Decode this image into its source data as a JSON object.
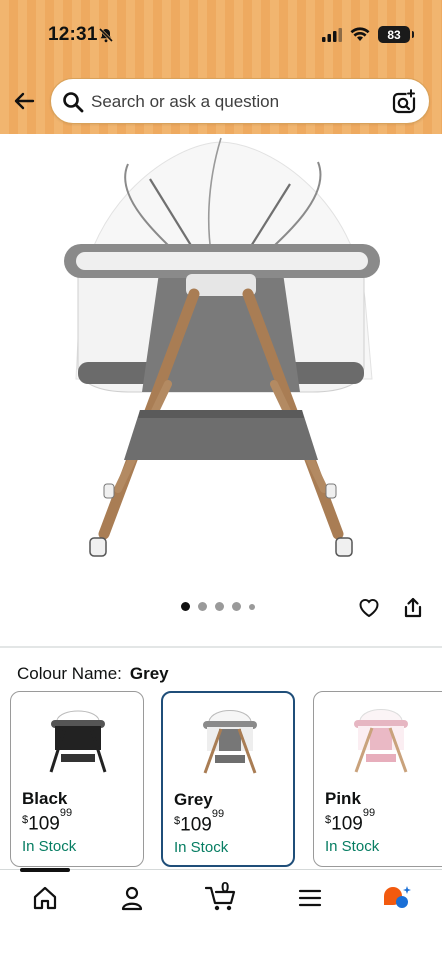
{
  "status_bar": {
    "time": "12:31",
    "battery": "83"
  },
  "search": {
    "placeholder": "Search or ask a question"
  },
  "gallery": {
    "dot_count": 5,
    "active_index": 0
  },
  "colour": {
    "label": "Colour Name:",
    "selected": "Grey"
  },
  "swatches": [
    {
      "name": "Black",
      "currency": "$",
      "price_whole": "109",
      "price_fraction": "99",
      "stock": "In Stock",
      "selected": false
    },
    {
      "name": "Grey",
      "currency": "$",
      "price_whole": "109",
      "price_fraction": "99",
      "stock": "In Stock",
      "selected": true
    },
    {
      "name": "Pink",
      "currency": "$",
      "price_whole": "109",
      "price_fraction": "99",
      "stock": "In Stock",
      "selected": false
    }
  ],
  "cart": {
    "count": "0"
  },
  "nav": [
    "home-icon",
    "account-icon",
    "cart-icon",
    "menu-icon",
    "rufus-assistant-icon"
  ],
  "colors": {
    "header": "#f1b56f",
    "stock_green": "#067d62",
    "selected_border": "#1f4e79"
  }
}
